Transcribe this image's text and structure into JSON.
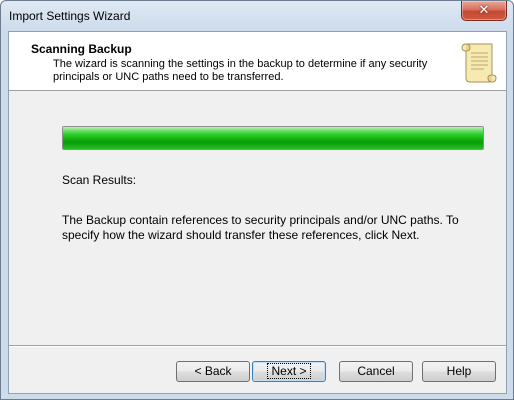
{
  "window": {
    "title": "Import Settings Wizard",
    "close_glyph": "✕"
  },
  "header": {
    "title": "Scanning Backup",
    "description": "The wizard is scanning the settings in the backup to determine if any security principals or UNC paths need to be transferred.",
    "icon": "scroll-icon"
  },
  "progress": {
    "value_percent": 100,
    "color": "#1fba1c"
  },
  "scan": {
    "label": "Scan Results:",
    "message": "The Backup contain references to security principals and/or UNC paths. To specify how the wizard should transfer these references, click Next."
  },
  "buttons": {
    "back": "< Back",
    "next": "Next >",
    "cancel": "Cancel",
    "help": "Help"
  }
}
